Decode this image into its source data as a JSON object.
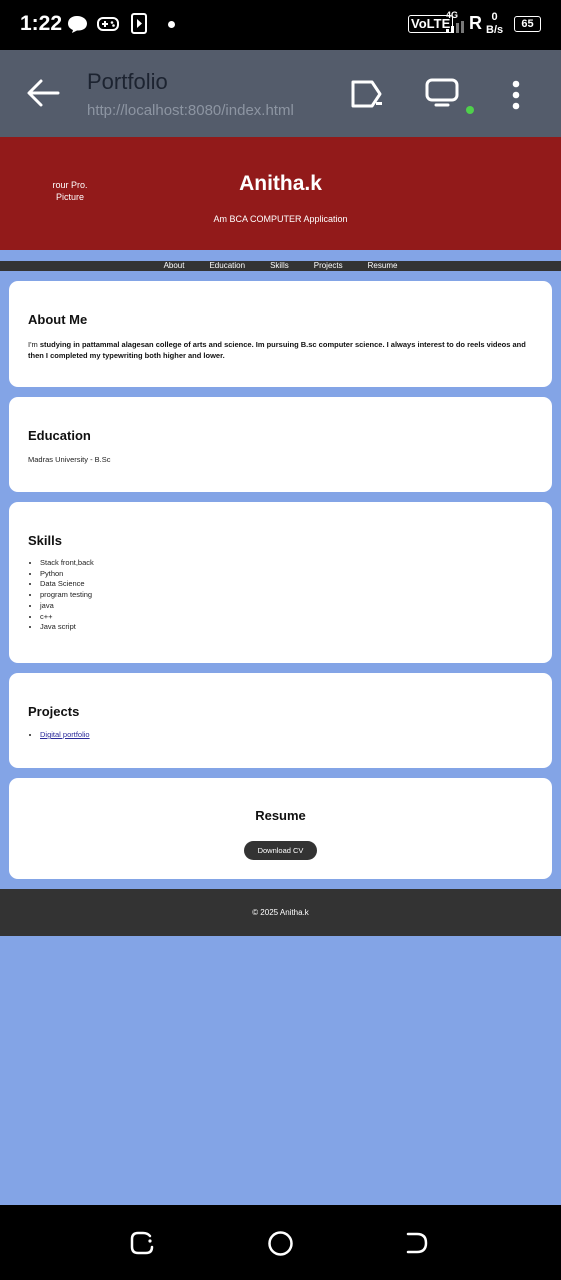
{
  "status": {
    "time": "1:22",
    "volte": "VoLTE",
    "network": "4G",
    "roaming": "R",
    "speed_value": "0",
    "speed_unit": "B/s",
    "battery": "65"
  },
  "app_bar": {
    "title": "Portfolio",
    "url": "http://localhost:8080/index.html"
  },
  "header": {
    "profile_alt": "Your Profile Picture",
    "profile_alt_visible": "rour Pro. Picture",
    "name": "Anitha.k",
    "tagline": "Am BCA COMPUTER Application",
    "background_color": "#921a1a"
  },
  "nav": {
    "items": [
      {
        "label": "About"
      },
      {
        "label": "Education"
      },
      {
        "label": "Skills"
      },
      {
        "label": "Projects"
      },
      {
        "label": "Resume"
      }
    ]
  },
  "about": {
    "heading": "About Me",
    "text_prefix": "I'm ",
    "text_bold": "studying in pattammal alagesan college of arts and science. Im pursuing B.sc computer science. I always interest to do reels videos and then I completed my typewriting both higher and lower."
  },
  "education": {
    "heading": "Education",
    "text": "Madras University - B.Sc"
  },
  "skills": {
    "heading": "Skills",
    "items": [
      "Stack front,back",
      "Python",
      "Data Science",
      "program testing",
      "java",
      "c++",
      "Java script"
    ]
  },
  "projects": {
    "heading": "Projects",
    "items": [
      {
        "label": "Digital portfolio"
      }
    ]
  },
  "resume": {
    "heading": "Resume",
    "button_label": "Download CV"
  },
  "footer": {
    "text": "© 2025 Anitha.k"
  },
  "colors": {
    "page_background": "#83a4e6",
    "app_bar": "#545c6b",
    "nav_background": "#333333"
  }
}
